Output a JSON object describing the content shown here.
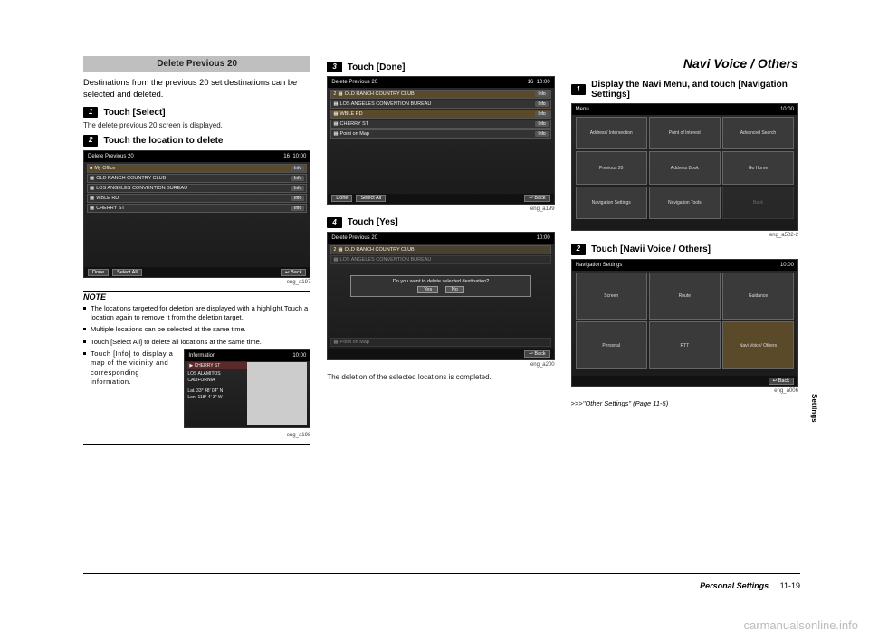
{
  "col1": {
    "header": "Delete Previous 20",
    "intro": "Destinations from the previous 20 set destinations can be selected and deleted.",
    "step1_num": "1",
    "step1_text": "Touch [Select]",
    "step1_sub": "The delete previous 20 screen is displayed.",
    "step2_num": "2",
    "step2_text": "Touch the location to delete",
    "fig1_cap": "eng_a197",
    "note_header": "NOTE",
    "bullets": {
      "b1": "The locations targeted for deletion are displayed with a highlight.Touch a location again to remove it from the deletion target.",
      "b2": "Multiple locations can be selected at the same time.",
      "b3": "Touch [Select All] to delete all locations at the same time.",
      "b4": "Touch [Info] to display a map of the vicinity and corresponding information."
    },
    "fig2_cap": "eng_a198",
    "screen1": {
      "title": "Delete  Previous  20",
      "count": "16",
      "time": "10:00",
      "rows": {
        "r1": "My Office",
        "r2": "OLD RANCH COUNTRY CLUB",
        "r3": "LOS ANGELES CONVENTION BUREAU",
        "r4": "WBLE RD",
        "r5": "CHERRY ST"
      },
      "info": "Info",
      "done": "Done",
      "select_all": "Select All",
      "back": "Back"
    },
    "info_screen": {
      "title": "Information",
      "time": "10:00",
      "dest": "CHERRY ST",
      "city": "LOS ALAMITOS\nCALIFORNIA",
      "lat": "Lat.   33° 48' 04\" N",
      "lon": "Lon. 118°  4'  3\"  W"
    }
  },
  "col2": {
    "step3_num": "3",
    "step3_text": "Touch [Done]",
    "fig3_cap": "eng_a199",
    "step4_num": "4",
    "step4_text": "Touch [Yes]",
    "fig4_cap": "eng_a200",
    "end_text": "The deletion of the selected locations is completed.",
    "screen3": {
      "title": "Delete  Previous  20",
      "count": "16",
      "time": "10:00",
      "rows": {
        "r1": "OLD RANCH COUNTRY CLUB",
        "r2": "LOS ANGELES CONVENTION BUREAU",
        "r3": "WBLE RD",
        "r4": "CHERRY ST"
      },
      "point": "Point on Map",
      "info": "Info",
      "done": "Done",
      "select_all": "Select All",
      "back": "Back"
    },
    "screen4": {
      "title": "Delete  Previous  20",
      "time": "10:00",
      "row1": "OLD RANCH COUNTRY CLUB",
      "row2": "LOS ANGELES CONVENTION BUREAU",
      "dialog": "Do you want to delete selected destination?",
      "yes": "Yes",
      "no": "No",
      "point": "Point on Map",
      "back": "Back"
    }
  },
  "col3": {
    "section_title": "Navi Voice / Others",
    "step1_num": "1",
    "step1_text": "Display the Navi Menu, and touch [Navigation Settings]",
    "fig5_cap": "eng_a502-2",
    "step2_num": "2",
    "step2_text": "Touch [Navii Voice / Others]",
    "fig6_cap": "eng_a006",
    "cross_arrows": ">>>",
    "cross_ref": "\"Other Settings\" (Page 11-5)",
    "menu_screen": {
      "title": "Menu",
      "time": "10:00",
      "cells": {
        "c1": "Address/\nIntersection",
        "c2": "Point of\nInterest",
        "c3": "Advanced\nSearch",
        "c4": "Previous\n20",
        "c5": "Address\nBook",
        "c6": "Go Home",
        "c7": "Navigation\nSettings",
        "c8": "Navigation\nTools",
        "c9": "Back"
      }
    },
    "settings_screen": {
      "title": "Navigation  Settings",
      "time": "10:00",
      "cells": {
        "c1": "Screen",
        "c2": "Route",
        "c3": "Guidance",
        "c4": "Personal",
        "c5": "RTT",
        "c6": "Navi Voice/\nOthers"
      },
      "back": "Back"
    }
  },
  "side_tab": "Settings",
  "footer": {
    "chapter": "Personal Settings",
    "page": "11-19"
  },
  "watermark": "carmanualsonline.info"
}
